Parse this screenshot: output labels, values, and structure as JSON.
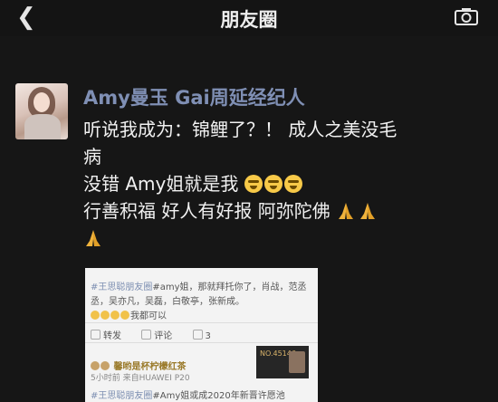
{
  "nav": {
    "back_icon": "chevron-left-icon",
    "title": "朋友圈",
    "camera_icon": "camera-icon"
  },
  "post": {
    "author": "Amy曼玉 Gai周延经纪人",
    "lines": [
      "听说我成为：锦鲤了？！ 成人之美没毛",
      "病",
      "没错 Amy姐就是我",
      "行善积福 好人有好报 阿弥陀佛"
    ],
    "emoji_icons": [
      "laugh-cry-emoji-icon",
      "praying-hands-emoji-icon"
    ]
  },
  "screenshot": {
    "row1_tag": "#王思聪朋友圈",
    "row1_text": "#amy姐，那就拜托你了，肖战，范丞",
    "row2": "丞，吴亦凡，吴磊，白敬亭，张新成。",
    "row3_text": "我都可以",
    "stats": [
      "转发",
      "评论",
      "3"
    ],
    "card_no": "NO.45146",
    "commenter": "馨哟是杯柠檬红茶",
    "device": "5小时前  来自HUAWEI P20",
    "row_last_tag": "#王思聪朋友圈",
    "row_last_text": "#Amy姐或成2020年新晋许愿池"
  },
  "colors": {
    "background": "#161616",
    "name": "#7f8fb4",
    "text": "#f1f1f1"
  }
}
